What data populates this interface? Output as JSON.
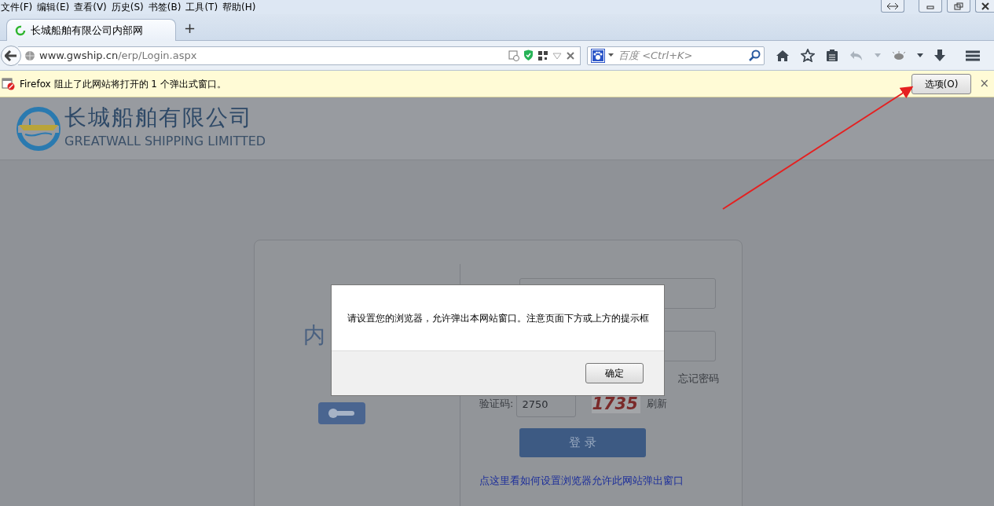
{
  "menu": [
    {
      "label": "文件(F)"
    },
    {
      "label": "编辑(E)"
    },
    {
      "label": "查看(V)"
    },
    {
      "label": "历史(S)"
    },
    {
      "label": "书签(B)"
    },
    {
      "label": "工具(T)"
    },
    {
      "label": "帮助(H)"
    }
  ],
  "tabs": [
    {
      "label": "长城船舶有限公司内部网",
      "selected": true
    }
  ],
  "new_tab": "+",
  "address": {
    "host": "www.gwship.cn",
    "path": "/erp/Login.aspx"
  },
  "search": {
    "placeholder": "百度 <Ctrl+K>"
  },
  "notification": {
    "message": "Firefox 阻止了此网站将打开的 1 个弹出式窗口。",
    "button": "选项(O)",
    "close": "×"
  },
  "page": {
    "company_cn": "长城船舶有限公司",
    "company_en": "GREATWALL SHIPPING LIMITTED",
    "login": {
      "title": "内",
      "forgot": "忘记密码",
      "captcha_label": "验证码:",
      "captcha_value": "2750",
      "captcha_image": "1735",
      "refresh": "刷新",
      "submit": "登 录",
      "help_link": "点这里看如何设置浏览器允许此网站弹出窗口"
    }
  },
  "dialog": {
    "message": "请设置您的浏览器，允许弹出本网站窗口。注意页面下方或上方的提示框",
    "button": "确定"
  }
}
